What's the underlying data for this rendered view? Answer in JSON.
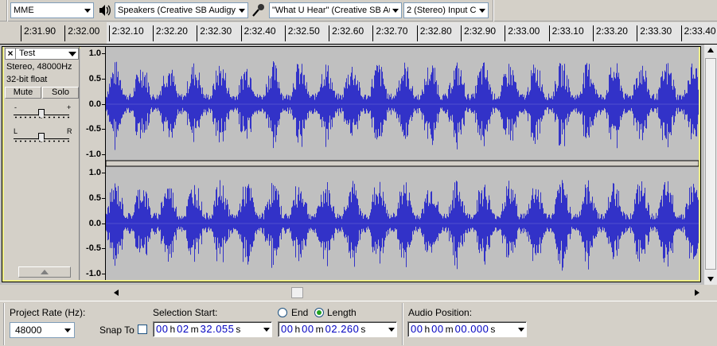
{
  "devices": {
    "host": "MME",
    "output_device": "Speakers (Creative SB Audigy",
    "input_device": "\"What U Hear\" (Creative SB Au",
    "input_channels": "2 (Stereo) Input C",
    "output_icon": "speaker-icon",
    "input_icon": "microphone-icon"
  },
  "ruler": {
    "ticks": [
      "2:31.90",
      "2:32.00",
      "2:32.10",
      "2:32.20",
      "2:32.30",
      "2:32.40",
      "2:32.50",
      "2:32.60",
      "2:32.70",
      "2:32.80",
      "2:32.90",
      "2:33.00",
      "2:33.10",
      "2:33.20",
      "2:33.30",
      "2:33.40"
    ]
  },
  "track": {
    "name": "Test",
    "format": "Stereo, 48000Hz",
    "bit_depth": "32-bit float",
    "mute_label": "Mute",
    "solo_label": "Solo",
    "gain_minus": "-",
    "gain_plus": "+",
    "pan_left": "L",
    "pan_right": "R",
    "gain_level": 0.5,
    "pan_level": 0.5,
    "close_icon": "close-icon",
    "menu_icon": "chevron-down-icon",
    "collapse_icon": "triangle-up-icon",
    "scale_top": [
      "1.0",
      "0.5",
      "0.0",
      "-0.5",
      "-1.0"
    ],
    "scale_bottom": [
      "1.0",
      "0.5",
      "0.0",
      "-0.5",
      "-1.0"
    ],
    "waveform_color": "#3232c8",
    "background_color": "#c0c0c0",
    "selection_color": "#eeee88"
  },
  "selection_bar": {
    "project_rate_label": "Project Rate (Hz):",
    "project_rate_value": "48000",
    "snap_to_label": "Snap To",
    "snap_to_checked": false,
    "selection_start_label": "Selection Start:",
    "end_label": "End",
    "length_label": "Length",
    "length_selected": true,
    "audio_position_label": "Audio Position:",
    "selection_start": {
      "hh": "00",
      "mm": "02",
      "ss": "32.055"
    },
    "selection_length": {
      "hh": "00",
      "mm": "00",
      "ss": "02.260"
    },
    "audio_position": {
      "hh": "00",
      "mm": "00",
      "ss": "00.000"
    },
    "unit_h": "h",
    "unit_m": "m",
    "unit_s": "s"
  }
}
